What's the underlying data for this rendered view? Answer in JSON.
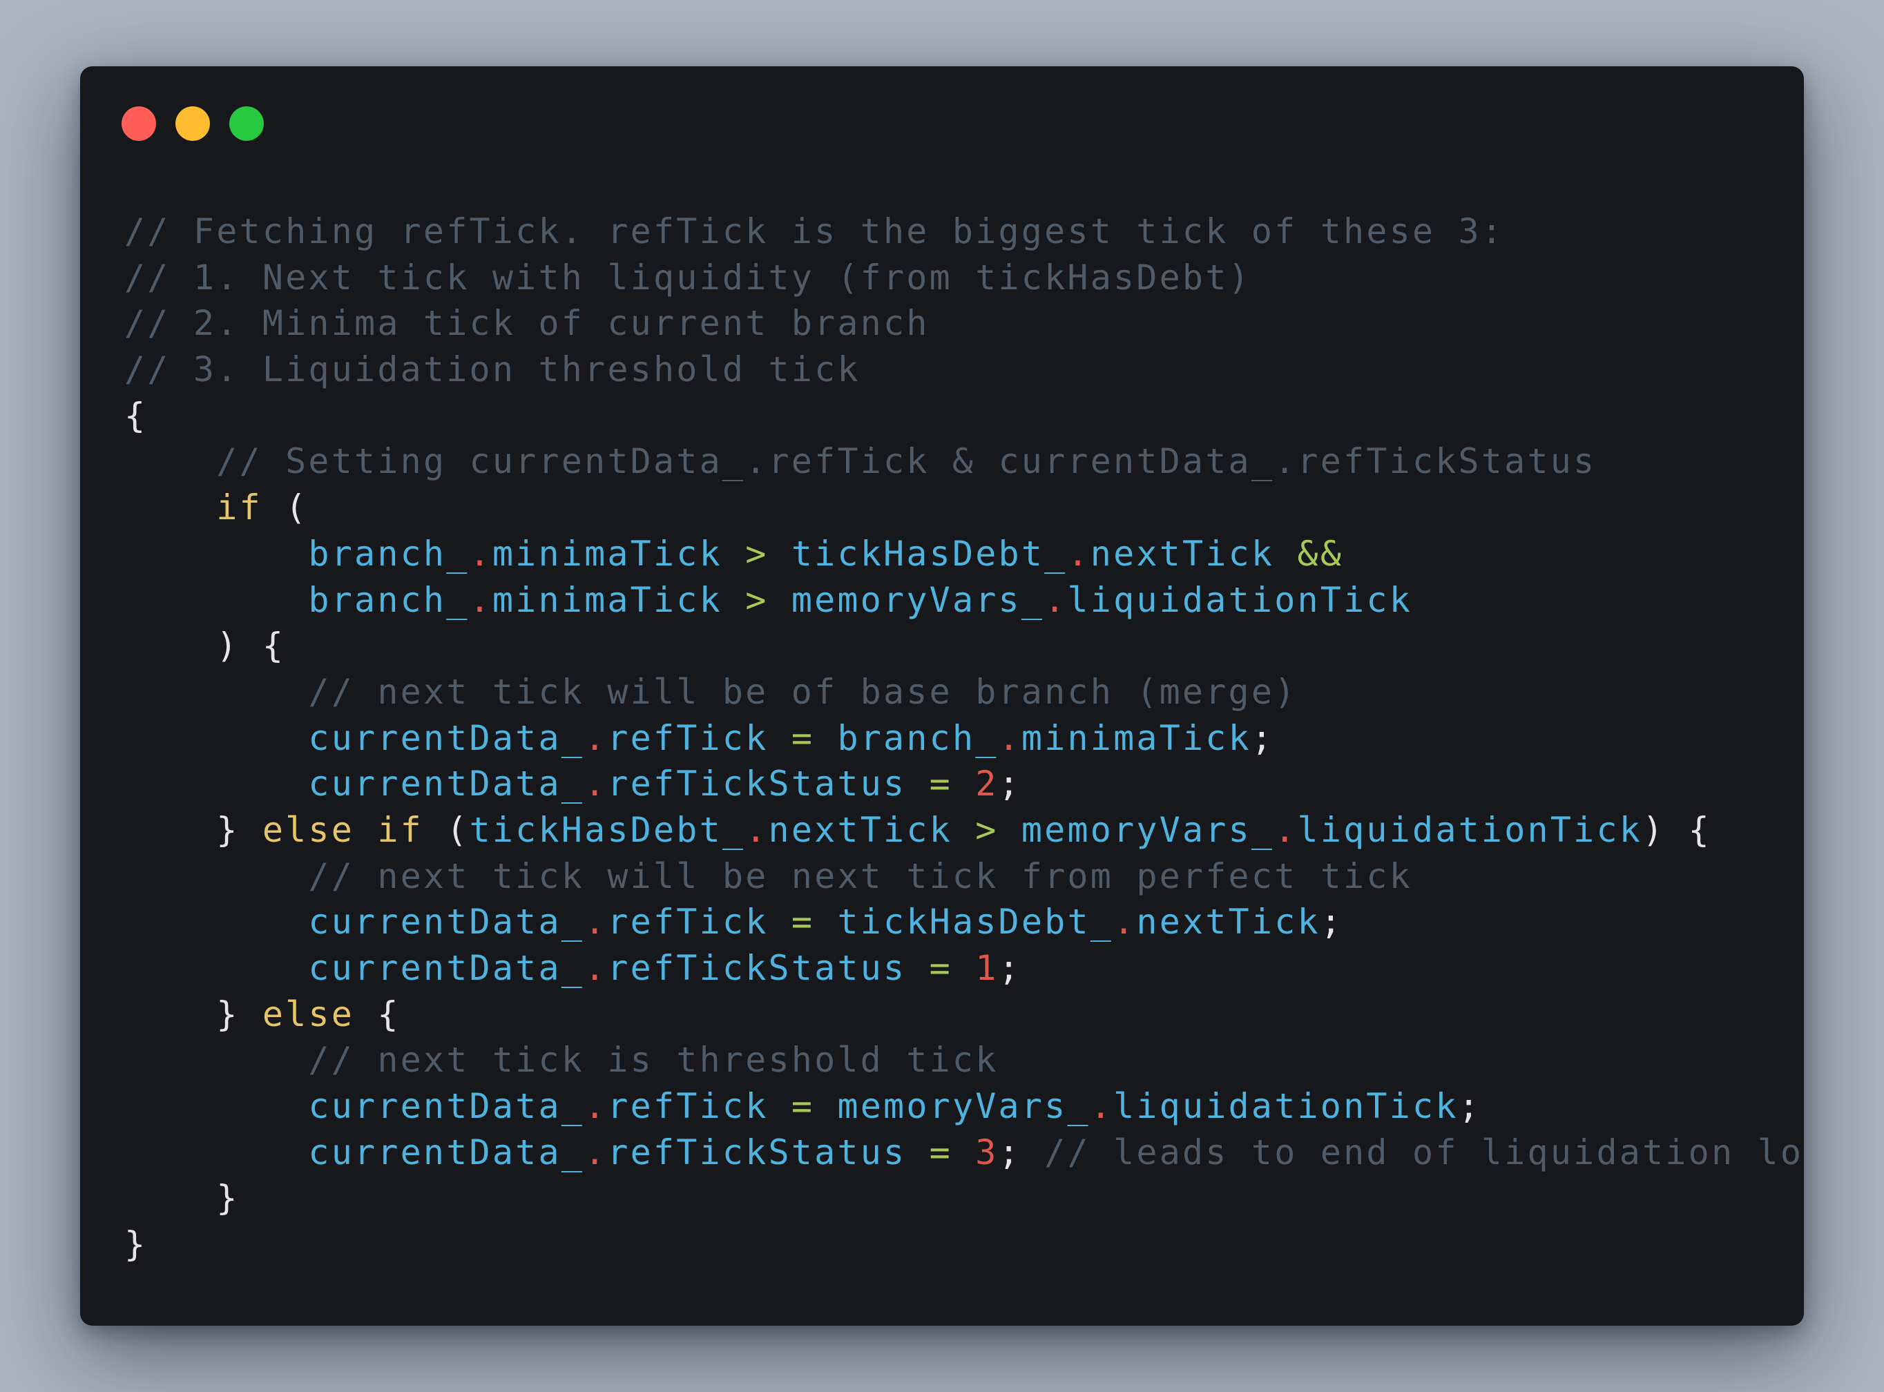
{
  "window": {
    "traffic_lights": [
      {
        "name": "close",
        "color": "#ff5f57"
      },
      {
        "name": "minimize",
        "color": "#febc2e"
      },
      {
        "name": "zoom",
        "color": "#28c840"
      }
    ]
  },
  "colors": {
    "background": "#a9b4c0",
    "window": "#16181b",
    "comment": "#4f5b66",
    "keyword": "#e5c567",
    "identifier": "#4fb3e0",
    "operator": "#a7c957",
    "number": "#e0584d",
    "punctuation": "#e6e6e6"
  },
  "code_lines": [
    [
      {
        "t": "comment",
        "v": "// Fetching refTick. refTick is the biggest tick of these 3:"
      }
    ],
    [
      {
        "t": "comment",
        "v": "// 1. Next tick with liquidity (from tickHasDebt)"
      }
    ],
    [
      {
        "t": "comment",
        "v": "// 2. Minima tick of current branch"
      }
    ],
    [
      {
        "t": "comment",
        "v": "// 3. Liquidation threshold tick"
      }
    ],
    [
      {
        "t": "punct",
        "v": "{"
      }
    ],
    [
      {
        "t": "space",
        "v": "    "
      },
      {
        "t": "comment",
        "v": "// Setting currentData_.refTick & currentData_.refTickStatus"
      }
    ],
    [
      {
        "t": "space",
        "v": "    "
      },
      {
        "t": "keyword",
        "v": "if"
      },
      {
        "t": "punct",
        "v": " ("
      }
    ],
    [
      {
        "t": "space",
        "v": "        "
      },
      {
        "t": "ident",
        "v": "branch_"
      },
      {
        "t": "dot",
        "v": "."
      },
      {
        "t": "ident",
        "v": "minimaTick"
      },
      {
        "t": "space",
        "v": " "
      },
      {
        "t": "op",
        "v": ">"
      },
      {
        "t": "space",
        "v": " "
      },
      {
        "t": "ident",
        "v": "tickHasDebt_"
      },
      {
        "t": "dot",
        "v": "."
      },
      {
        "t": "ident",
        "v": "nextTick"
      },
      {
        "t": "space",
        "v": " "
      },
      {
        "t": "op",
        "v": "&&"
      }
    ],
    [
      {
        "t": "space",
        "v": "        "
      },
      {
        "t": "ident",
        "v": "branch_"
      },
      {
        "t": "dot",
        "v": "."
      },
      {
        "t": "ident",
        "v": "minimaTick"
      },
      {
        "t": "space",
        "v": " "
      },
      {
        "t": "op",
        "v": ">"
      },
      {
        "t": "space",
        "v": " "
      },
      {
        "t": "ident",
        "v": "memoryVars_"
      },
      {
        "t": "dot",
        "v": "."
      },
      {
        "t": "ident",
        "v": "liquidationTick"
      }
    ],
    [
      {
        "t": "space",
        "v": "    "
      },
      {
        "t": "punct",
        "v": ") {"
      }
    ],
    [
      {
        "t": "space",
        "v": "        "
      },
      {
        "t": "comment",
        "v": "// next tick will be of base branch (merge)"
      }
    ],
    [
      {
        "t": "space",
        "v": "        "
      },
      {
        "t": "ident",
        "v": "currentData_"
      },
      {
        "t": "dot",
        "v": "."
      },
      {
        "t": "ident",
        "v": "refTick"
      },
      {
        "t": "space",
        "v": " "
      },
      {
        "t": "op",
        "v": "="
      },
      {
        "t": "space",
        "v": " "
      },
      {
        "t": "ident",
        "v": "branch_"
      },
      {
        "t": "dot",
        "v": "."
      },
      {
        "t": "ident",
        "v": "minimaTick"
      },
      {
        "t": "punct",
        "v": ";"
      }
    ],
    [
      {
        "t": "space",
        "v": "        "
      },
      {
        "t": "ident",
        "v": "currentData_"
      },
      {
        "t": "dot",
        "v": "."
      },
      {
        "t": "ident",
        "v": "refTickStatus"
      },
      {
        "t": "space",
        "v": " "
      },
      {
        "t": "op",
        "v": "="
      },
      {
        "t": "space",
        "v": " "
      },
      {
        "t": "num",
        "v": "2"
      },
      {
        "t": "punct",
        "v": ";"
      }
    ],
    [
      {
        "t": "space",
        "v": "    "
      },
      {
        "t": "punct",
        "v": "} "
      },
      {
        "t": "keyword",
        "v": "else if"
      },
      {
        "t": "punct",
        "v": " ("
      },
      {
        "t": "ident",
        "v": "tickHasDebt_"
      },
      {
        "t": "dot",
        "v": "."
      },
      {
        "t": "ident",
        "v": "nextTick"
      },
      {
        "t": "space",
        "v": " "
      },
      {
        "t": "op",
        "v": ">"
      },
      {
        "t": "space",
        "v": " "
      },
      {
        "t": "ident",
        "v": "memoryVars_"
      },
      {
        "t": "dot",
        "v": "."
      },
      {
        "t": "ident",
        "v": "liquidationTick"
      },
      {
        "t": "punct",
        "v": ") {"
      }
    ],
    [
      {
        "t": "space",
        "v": "        "
      },
      {
        "t": "comment",
        "v": "// next tick will be next tick from perfect tick"
      }
    ],
    [
      {
        "t": "space",
        "v": "        "
      },
      {
        "t": "ident",
        "v": "currentData_"
      },
      {
        "t": "dot",
        "v": "."
      },
      {
        "t": "ident",
        "v": "refTick"
      },
      {
        "t": "space",
        "v": " "
      },
      {
        "t": "op",
        "v": "="
      },
      {
        "t": "space",
        "v": " "
      },
      {
        "t": "ident",
        "v": "tickHasDebt_"
      },
      {
        "t": "dot",
        "v": "."
      },
      {
        "t": "ident",
        "v": "nextTick"
      },
      {
        "t": "punct",
        "v": ";"
      }
    ],
    [
      {
        "t": "space",
        "v": "        "
      },
      {
        "t": "ident",
        "v": "currentData_"
      },
      {
        "t": "dot",
        "v": "."
      },
      {
        "t": "ident",
        "v": "refTickStatus"
      },
      {
        "t": "space",
        "v": " "
      },
      {
        "t": "op",
        "v": "="
      },
      {
        "t": "space",
        "v": " "
      },
      {
        "t": "num",
        "v": "1"
      },
      {
        "t": "punct",
        "v": ";"
      }
    ],
    [
      {
        "t": "space",
        "v": "    "
      },
      {
        "t": "punct",
        "v": "} "
      },
      {
        "t": "keyword",
        "v": "else"
      },
      {
        "t": "punct",
        "v": " {"
      }
    ],
    [
      {
        "t": "space",
        "v": "        "
      },
      {
        "t": "comment",
        "v": "// next tick is threshold tick"
      }
    ],
    [
      {
        "t": "space",
        "v": "        "
      },
      {
        "t": "ident",
        "v": "currentData_"
      },
      {
        "t": "dot",
        "v": "."
      },
      {
        "t": "ident",
        "v": "refTick"
      },
      {
        "t": "space",
        "v": " "
      },
      {
        "t": "op",
        "v": "="
      },
      {
        "t": "space",
        "v": " "
      },
      {
        "t": "ident",
        "v": "memoryVars_"
      },
      {
        "t": "dot",
        "v": "."
      },
      {
        "t": "ident",
        "v": "liquidationTick"
      },
      {
        "t": "punct",
        "v": ";"
      }
    ],
    [
      {
        "t": "space",
        "v": "        "
      },
      {
        "t": "ident",
        "v": "currentData_"
      },
      {
        "t": "dot",
        "v": "."
      },
      {
        "t": "ident",
        "v": "refTickStatus"
      },
      {
        "t": "space",
        "v": " "
      },
      {
        "t": "op",
        "v": "="
      },
      {
        "t": "space",
        "v": " "
      },
      {
        "t": "num",
        "v": "3"
      },
      {
        "t": "punct",
        "v": ";"
      },
      {
        "t": "space",
        "v": " "
      },
      {
        "t": "comment",
        "v": "// leads to end of liquidation loop"
      }
    ],
    [
      {
        "t": "space",
        "v": "    "
      },
      {
        "t": "punct",
        "v": "}"
      }
    ],
    [
      {
        "t": "punct",
        "v": "}"
      }
    ]
  ]
}
